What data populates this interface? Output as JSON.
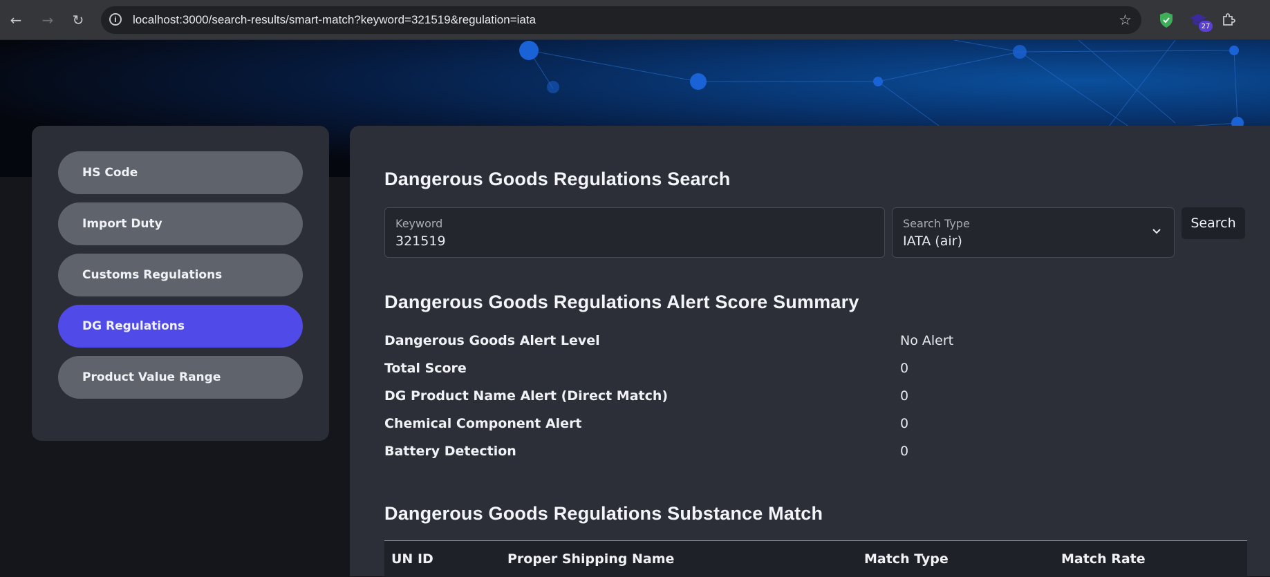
{
  "browser": {
    "url": "localhost:3000/search-results/smart-match?keyword=321519&regulation=iata",
    "extension_badge": "27"
  },
  "sidebar": {
    "items": [
      {
        "label": "HS Code"
      },
      {
        "label": "Import Duty"
      },
      {
        "label": "Customs Regulations"
      },
      {
        "label": "DG Regulations",
        "active": true
      },
      {
        "label": "Product Value Range"
      }
    ]
  },
  "search": {
    "title": "Dangerous Goods Regulations Search",
    "keyword_label": "Keyword",
    "keyword_value": "321519",
    "type_label": "Search Type",
    "type_value": "IATA (air)",
    "button_label": "Search"
  },
  "summary": {
    "title": "Dangerous Goods Regulations Alert Score Summary",
    "rows": [
      {
        "key": "Dangerous Goods Alert Level",
        "value": "No Alert"
      },
      {
        "key": "Total Score",
        "value": "0"
      },
      {
        "key": "DG Product Name Alert (Direct Match)",
        "value": "0"
      },
      {
        "key": "Chemical Component Alert",
        "value": "0"
      },
      {
        "key": "Battery Detection",
        "value": "0"
      }
    ]
  },
  "substance": {
    "title": "Dangerous Goods Regulations Substance Match",
    "columns": [
      "UN ID",
      "Proper Shipping Name",
      "Match Type",
      "Match Rate"
    ]
  },
  "colors": {
    "accent": "#4f4ae8",
    "nav_item": "#5f636c",
    "panel": "#2c2f38"
  }
}
